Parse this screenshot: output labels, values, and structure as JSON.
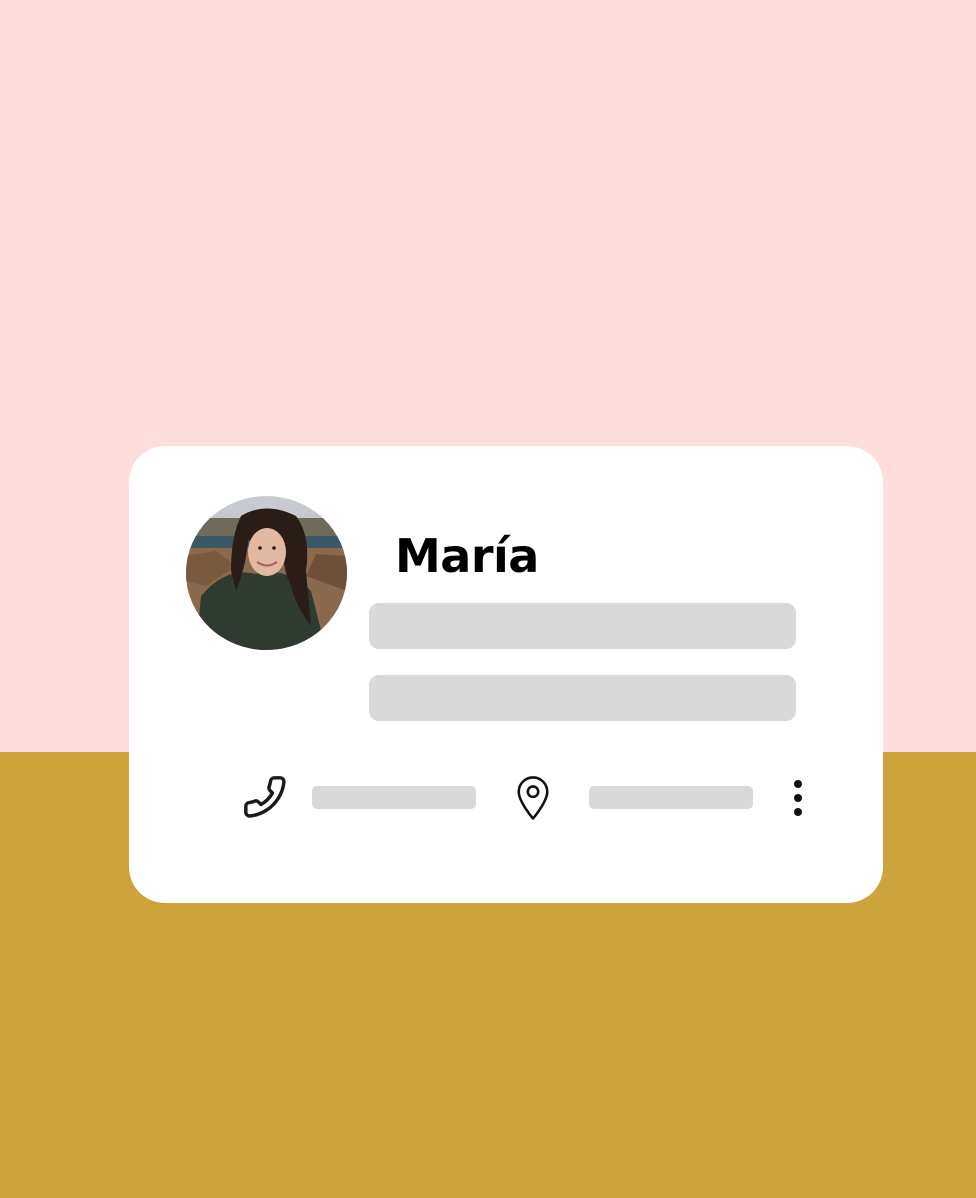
{
  "colors": {
    "background_top": "#FFDDDD",
    "background_bottom": "#CDA43C",
    "card": "#FFFFFF",
    "skeleton": "#D9D9D9",
    "text": "#000000"
  },
  "profile": {
    "name": "María",
    "avatar": "profile-photo"
  },
  "contact": {
    "phone_icon": "phone-icon",
    "location_icon": "location-pin-icon",
    "more_icon": "more-vertical-icon"
  }
}
